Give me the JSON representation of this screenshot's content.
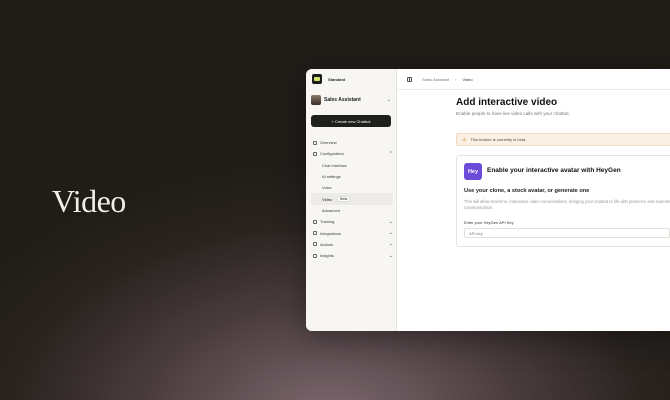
{
  "hero": {
    "title": "Video"
  },
  "sidebar": {
    "workspace": "Standard",
    "bot_name": "Sales Assistant",
    "create_button": "+ Create new Chatbot",
    "nav": [
      {
        "label": "Overview",
        "icon": "home-icon",
        "chevron": false
      },
      {
        "label": "Configuration",
        "icon": "chat-icon",
        "chevron": true
      },
      {
        "label": "Chat interface",
        "sub": true
      },
      {
        "label": "AI settings",
        "sub": true
      },
      {
        "label": "Voice",
        "sub": true
      },
      {
        "label": "Video",
        "sub": true,
        "active": true,
        "badge": "Beta"
      },
      {
        "label": "Advanced",
        "sub": true
      },
      {
        "label": "Training",
        "icon": "book-icon",
        "chevron": true
      },
      {
        "label": "Integrations",
        "icon": "plug-icon",
        "chevron": true
      },
      {
        "label": "Actions",
        "icon": "bolt-icon",
        "chevron": true
      },
      {
        "label": "Insights",
        "icon": "chart-icon",
        "chevron": true
      }
    ]
  },
  "topbar": {
    "crumb_1": "Sales Assistant",
    "separator": "›",
    "crumb_2": "Video"
  },
  "main": {
    "title": "Add interactive video",
    "subtitle": "Enable people to have live video calls with your chatbot.",
    "banner": "This feature is currently in beta.",
    "card": {
      "logo": "Hey",
      "title": "Enable your interactive avatar with HeyGen",
      "subtitle": "Use your clone, a stock avatar, or generate one",
      "description": "This will allow real-time, interactive video conversations, bringing your chatbot to life with presence and seamless communication.",
      "field_label": "Enter your HeyGen API Key",
      "placeholder": "API key"
    }
  }
}
